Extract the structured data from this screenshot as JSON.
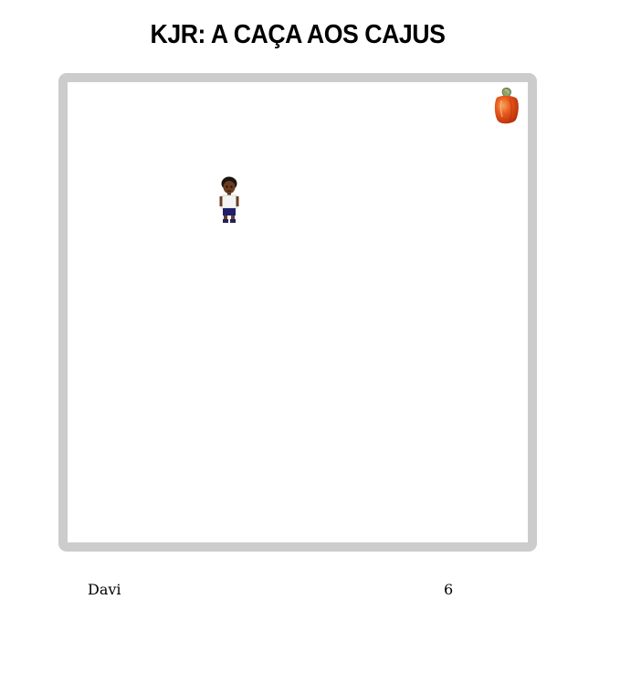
{
  "game": {
    "title": "KJR: A CAÇA AOS CAJUS",
    "player_name": "Davi",
    "score": "6"
  },
  "board": {
    "border_color": "#cccccc",
    "background": "#ffffff",
    "sprites": [
      {
        "name": "cashew-icon",
        "kind": "cashew"
      },
      {
        "name": "player-character",
        "kind": "player"
      }
    ]
  }
}
